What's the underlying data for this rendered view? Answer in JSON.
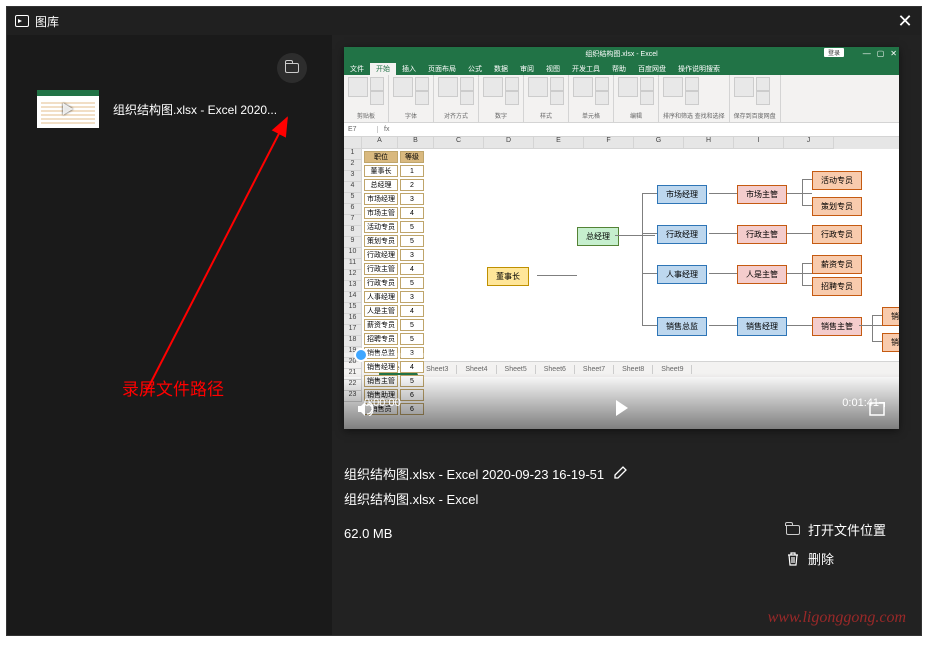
{
  "window": {
    "title": "图库"
  },
  "sidebar": {
    "thumb_label": "组织结构图.xlsx - Excel 2020..."
  },
  "annotation": {
    "text": "录屏文件路径"
  },
  "video": {
    "time_current": "0:00:00",
    "time_total": "0:01:41",
    "excel_title": "组织结构图.xlsx - Excel",
    "login": "登录",
    "tabs": [
      "文件",
      "开始",
      "插入",
      "页面布局",
      "公式",
      "数据",
      "审阅",
      "视图",
      "开发工具",
      "帮助",
      "百度网盘",
      "操作说明搜索"
    ],
    "ribbon_groups": [
      "剪贴板",
      "字体",
      "对齐方式",
      "数字",
      "样式",
      "单元格",
      "编辑",
      "排序和筛选 查找和选择",
      "保存到百度网盘"
    ],
    "namebox": "E7",
    "col_headers": [
      "A",
      "B",
      "C",
      "D",
      "E",
      "F",
      "G",
      "H",
      "I",
      "J"
    ],
    "table_headers": [
      "职位",
      "等级"
    ],
    "table_rows": [
      [
        "董事长",
        "1"
      ],
      [
        "总经理",
        "2"
      ],
      [
        "市场经理",
        "3"
      ],
      [
        "市场主管",
        "4"
      ],
      [
        "活动专员",
        "5"
      ],
      [
        "策划专员",
        "5"
      ],
      [
        "行政经理",
        "3"
      ],
      [
        "行政主管",
        "4"
      ],
      [
        "行政专员",
        "5"
      ],
      [
        "人事经理",
        "3"
      ],
      [
        "人是主管",
        "4"
      ],
      [
        "薪资专员",
        "5"
      ],
      [
        "招聘专员",
        "5"
      ],
      [
        "销售总监",
        "3"
      ],
      [
        "销售经理",
        "4"
      ],
      [
        "销售主管",
        "5"
      ],
      [
        "销售助理",
        "6"
      ],
      [
        "销售员",
        "6"
      ]
    ],
    "org": {
      "l1": "董事长",
      "l2": "总经理",
      "l3": [
        "市场经理",
        "行政经理",
        "人事经理",
        "销售总监"
      ],
      "l4": [
        "市场主管",
        "行政主管",
        "人是主管",
        "销售经理",
        "销售主管"
      ],
      "l5": [
        "活动专员",
        "策划专员",
        "行政专员",
        "薪资专员",
        "招聘专员",
        "销售助理",
        "销售员"
      ]
    },
    "sheets": [
      "Sheet2",
      "Sheet3",
      "Sheet4",
      "Sheet5",
      "Sheet6",
      "Sheet7",
      "Sheet8",
      "Sheet9"
    ]
  },
  "meta": {
    "filename_full": "组织结构图.xlsx - Excel 2020-09-23 16-19-51",
    "filename_short": "组织结构图.xlsx - Excel",
    "filesize": "62.0 MB",
    "open_location": "打开文件位置",
    "delete": "删除"
  },
  "watermark": "www.ligonggong.com"
}
